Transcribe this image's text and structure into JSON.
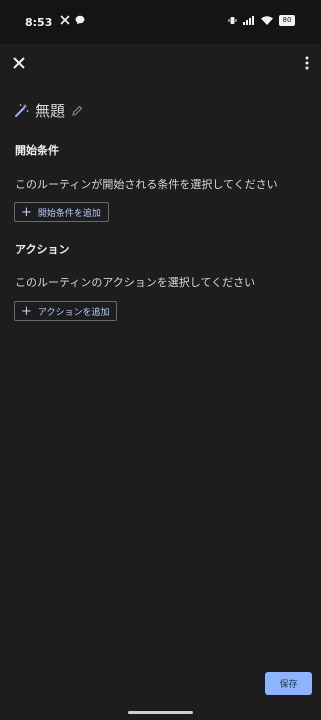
{
  "status_bar": {
    "time": "8:53",
    "battery": "80",
    "left_icons": [
      "x-logo-icon",
      "chat-bubble-icon"
    ],
    "right_icons": [
      "vibrate-icon",
      "signal-icon",
      "wifi-icon",
      "battery-icon"
    ]
  },
  "app_bar": {
    "close_icon": "close-icon",
    "more_icon": "more-vertical-icon"
  },
  "routine": {
    "title": "無題",
    "title_icon": "magic-wand-icon",
    "edit_icon": "pencil-icon"
  },
  "start_conditions": {
    "heading": "開始条件",
    "description": "このルーティンが開始される条件を選択してください",
    "add_button_label": "開始条件を追加"
  },
  "actions": {
    "heading": "アクション",
    "description": "このルーティンのアクションを選択してください",
    "add_button_label": "アクションを追加"
  },
  "footer": {
    "save_label": "保存"
  },
  "colors": {
    "background": "#1d1d1f",
    "accent": "#8fb3ff",
    "link_text": "#b7cbff"
  }
}
